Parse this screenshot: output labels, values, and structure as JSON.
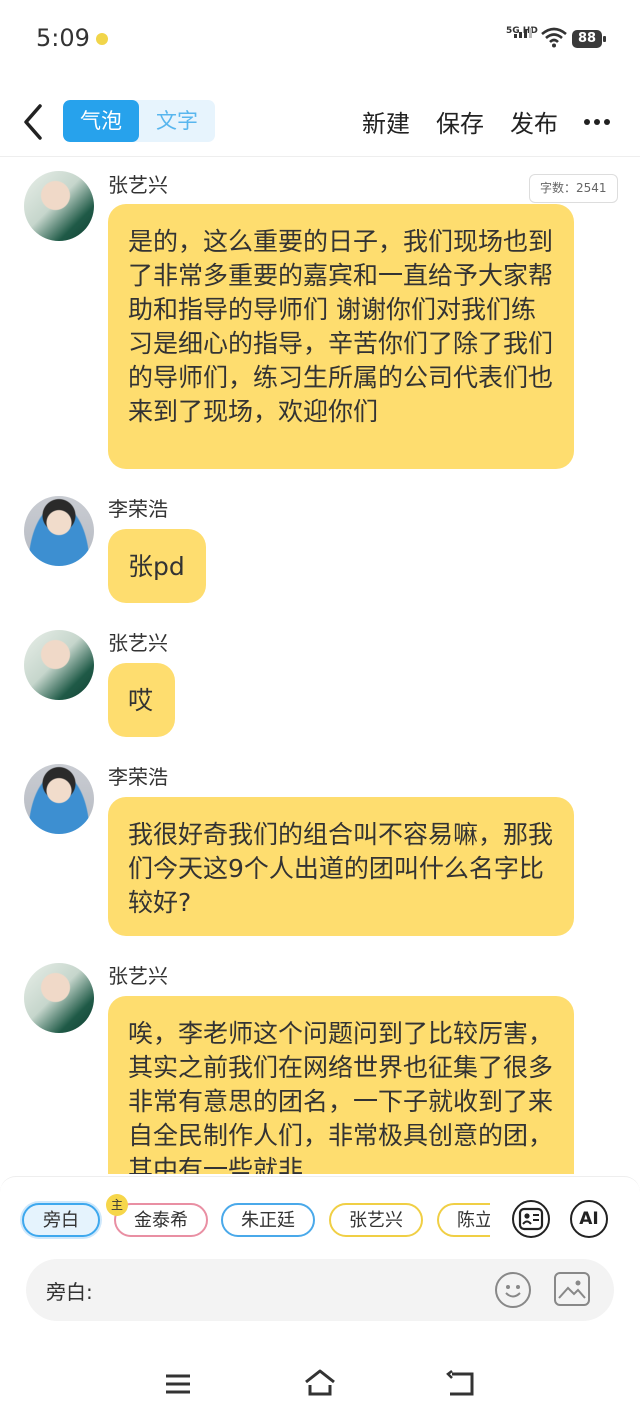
{
  "status": {
    "time": "5:09",
    "network": "5G HD",
    "battery": "88"
  },
  "toolbar": {
    "mode_bubble": "气泡",
    "mode_text": "文字",
    "new_label": "新建",
    "save_label": "保存",
    "publish_label": "发布"
  },
  "chat": {
    "word_count": "字数：2541",
    "messages": [
      {
        "speaker": "张艺兴",
        "text": "是的，这么重要的日子，我们现场也到了非常多重要的嘉宾和一直给予大家帮助和指导的导师们 谢谢你们对我们练习是细心的指导，辛苦你们了除了我们的导师们，练习生所属的公司代表们也来到了现场，欢迎你们"
      },
      {
        "speaker": "李荣浩",
        "text": "张pd"
      },
      {
        "speaker": "张艺兴",
        "text": "哎"
      },
      {
        "speaker": "李荣浩",
        "text": "我很好奇我们的组合叫不容易嘛，那我们今天这9个人出道的团叫什么名字比较好?"
      },
      {
        "speaker": "张艺兴",
        "text": "唉，李老师这个问题问到了比较厉害，其实之前我们在网络世界也征集了很多非常有意思的团名，一下子就收到了来自全民制作人们，非常极具创意的团，其中有一些就非"
      }
    ]
  },
  "roles": {
    "narrator": "旁白",
    "host_badge": "主",
    "chips": [
      "金泰希",
      "朱正廷",
      "张艺兴",
      "陈立"
    ],
    "ai_label": "AI"
  },
  "input": {
    "label": "旁白:"
  },
  "colors": {
    "accent": "#27a2ec",
    "bubble": "#fedd6f"
  }
}
